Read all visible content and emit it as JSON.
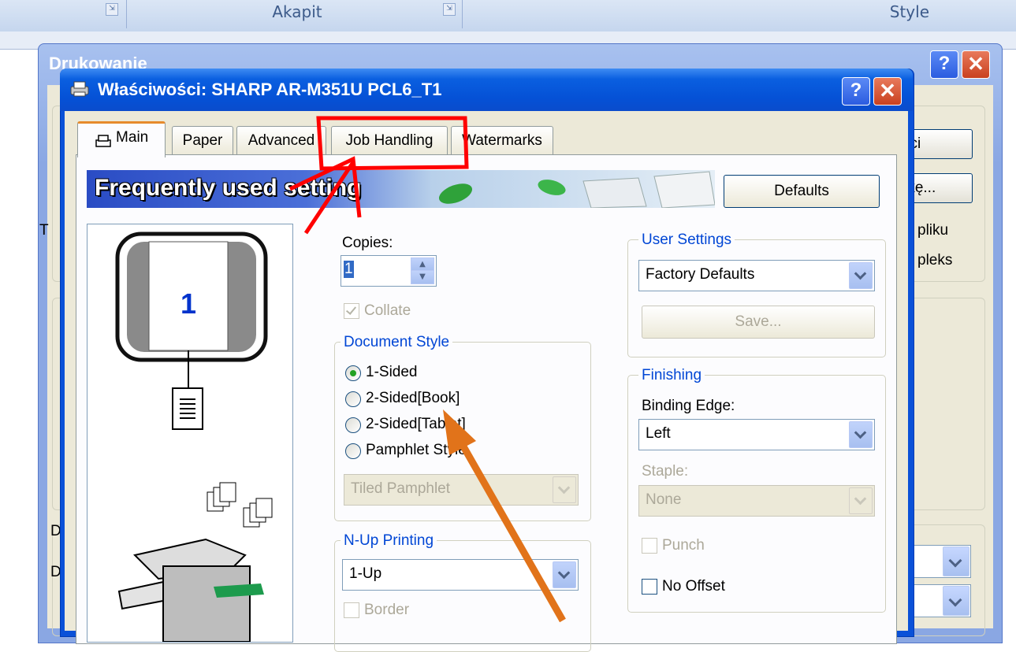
{
  "ribbon": {
    "section1": "Akapit",
    "section2": "Style",
    "launcher": "⇲"
  },
  "back_dialog": {
    "title": "Drukowanie",
    "help_glyph": "?",
    "close_glyph": "✕",
    "btn_properties": "ści",
    "btn_marks": "rkę...",
    "text_file": "pliku",
    "text_duplex": "pleks",
    "letter_t": "T",
    "letter_d1": "D",
    "letter_d2": "D"
  },
  "dialog": {
    "title": "Właściwości: SHARP AR-M351U PCL6_T1",
    "help_glyph": "?",
    "close_glyph": "✕"
  },
  "tabs": [
    "Main",
    "Paper",
    "Advanced",
    "Job Handling",
    "Watermarks"
  ],
  "banner": {
    "text": "Frequently used setting"
  },
  "defaults_button": "Defaults",
  "preview": {
    "page_number": "1"
  },
  "copies": {
    "label": "Copies:",
    "value": "1"
  },
  "collate": {
    "label": "Collate",
    "checked": true
  },
  "document_style": {
    "legend": "Document Style",
    "options": [
      "1-Sided",
      "2-Sided[Book]",
      "2-Sided[Tablet]",
      "Pamphlet Style"
    ],
    "selected": "1-Sided",
    "pamphlet_value": "Tiled Pamphlet"
  },
  "nup": {
    "legend": "N-Up Printing",
    "value": "1-Up",
    "border_label": "Border"
  },
  "user_settings": {
    "legend": "User Settings",
    "value": "Factory Defaults",
    "save_label": "Save..."
  },
  "finishing": {
    "legend": "Finishing",
    "binding_label": "Binding Edge:",
    "binding_value": "Left",
    "staple_label": "Staple:",
    "staple_value": "None",
    "punch_label": "Punch",
    "no_offset_label": "No Offset"
  },
  "annotations": {
    "red_color": "#ff0000",
    "orange_color": "#e1731a"
  }
}
